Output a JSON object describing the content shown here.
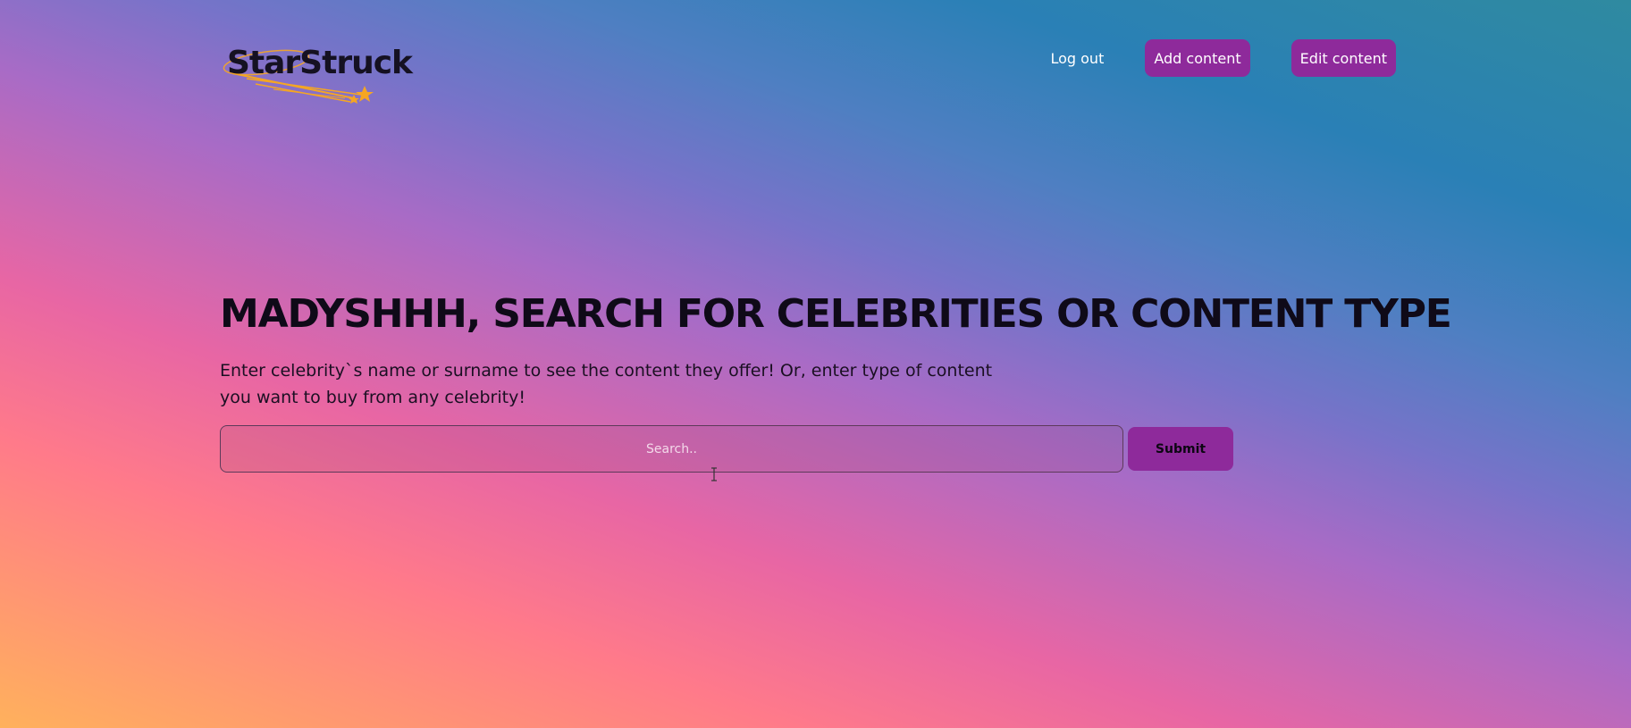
{
  "header": {
    "logo_text": "StarStruck",
    "nav": {
      "logout_label": "Log out",
      "add_content_label": "Add content",
      "edit_content_label": "Edit content"
    }
  },
  "hero": {
    "title": "Madyshhh, search for celebrities or content type",
    "description": "Enter celebrity`s name or surname to see the content they offer! Or, enter type of content you want to buy from any celebrity!"
  },
  "search": {
    "placeholder": "Search..",
    "value": "",
    "submit_label": "Submit"
  },
  "colors": {
    "accent": "#8e2a9b",
    "logo_star": "#f5a623",
    "text_dark": "#0f0a18"
  },
  "icons": {
    "logo": "shooting-star-icon",
    "cursor": "text-cursor-icon"
  }
}
